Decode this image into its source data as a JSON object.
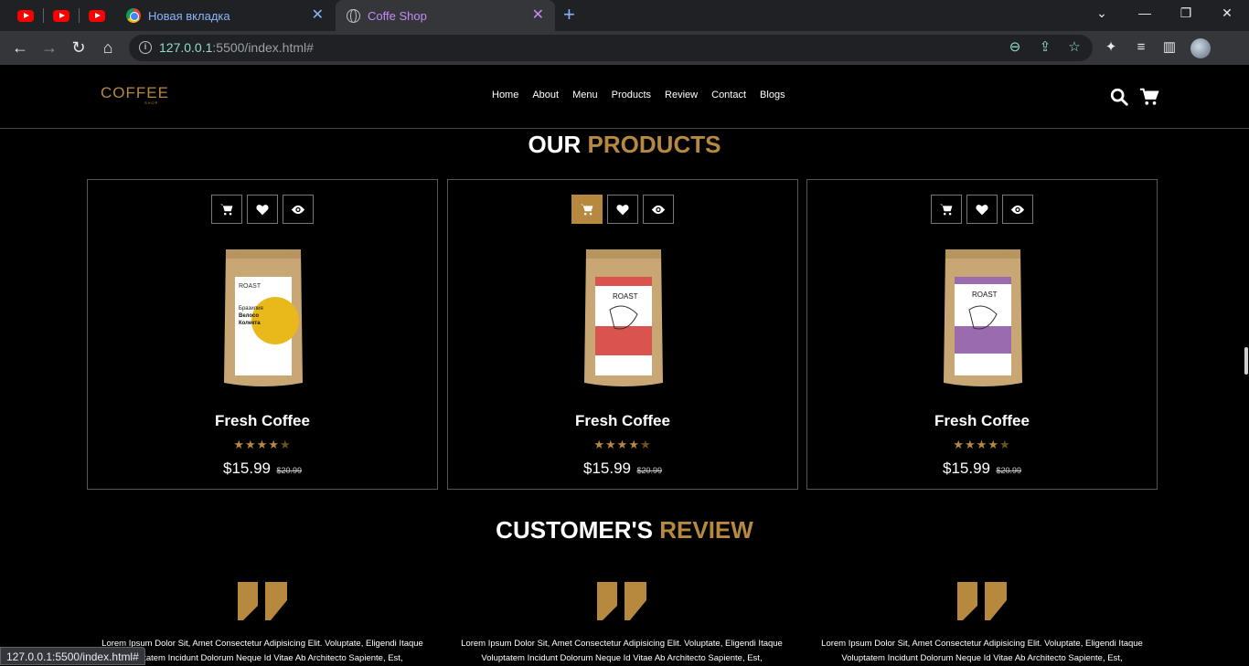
{
  "browser": {
    "tabs": [
      {
        "title": "Новая вкладка",
        "icon": "chrome-icon"
      },
      {
        "title": "Coffe Shop",
        "icon": "globe-icon",
        "active": true
      }
    ],
    "url_host": "127.0.0.1",
    "url_rest": ":5500/index.html#",
    "status_url": "127.0.0.1:5500/index.html#"
  },
  "header": {
    "logo": "COFFEE",
    "logo_sub": "SHOP",
    "nav": [
      "Home",
      "About",
      "Menu",
      "Products",
      "Review",
      "Contact",
      "Blogs"
    ]
  },
  "products": {
    "title_main": "OUR",
    "title_accent": "PRODUCTS",
    "items": [
      {
        "name": "Fresh Coffee",
        "rating": "4.5",
        "price": "$15.99",
        "old_price": "$20.99",
        "bag_color": "#e9b91c",
        "label": "ROAST",
        "label_text": "Бразилия Велосо Колекта"
      },
      {
        "name": "Fresh Coffee",
        "rating": "4.5",
        "price": "$15.99",
        "old_price": "$20.99",
        "bag_color": "#d9534f",
        "label": "ROAST",
        "label_text": "",
        "cart_active": true
      },
      {
        "name": "Fresh Coffee",
        "rating": "4.5",
        "price": "$15.99",
        "old_price": "$20.99",
        "bag_color": "#9b6bb0",
        "label": "ROAST",
        "label_text": ""
      }
    ]
  },
  "reviews": {
    "title_main": "CUSTOMER'S",
    "title_accent": "REVIEW",
    "items": [
      {
        "text": "Lorem Ipsum Dolor Sit, Amet Consectetur Adipisicing Elit. Voluptate, Eligendi Itaque Voluptatem Incidunt Dolorum Neque Id Vitae Ab Architecto Sapiente, Est,"
      },
      {
        "text": "Lorem Ipsum Dolor Sit, Amet Consectetur Adipisicing Elit. Voluptate, Eligendi Itaque Voluptatem Incidunt Dolorum Neque Id Vitae Ab Architecto Sapiente, Est,"
      },
      {
        "text": "Lorem Ipsum Dolor Sit, Amet Consectetur Adipisicing Elit. Voluptate, Eligendi Itaque Voluptatem Incidunt Dolorum Neque Id Vitae Ab Architecto Sapiente, Est,"
      }
    ]
  },
  "colors": {
    "accent": "#b6893e",
    "background": "#000000"
  }
}
